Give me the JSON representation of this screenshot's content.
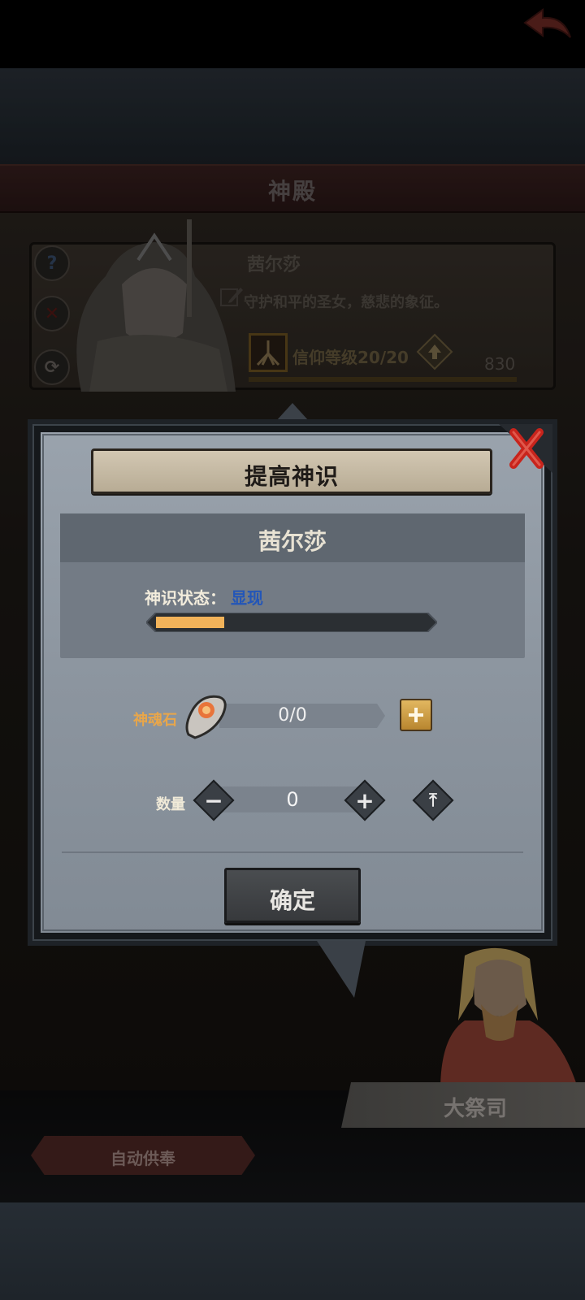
{
  "header": {
    "title": "神殿"
  },
  "hero": {
    "name": "茜尔莎",
    "description": "守护和平的圣女，慈悲的象征。",
    "faith_label": "信仰等级20/20",
    "faith_value": "830",
    "side_buttons": [
      "help-icon",
      "close-icon",
      "refresh-icon"
    ]
  },
  "dialog": {
    "title": "提高神识",
    "character_name": "茜尔莎",
    "state_label": "神识状态：",
    "state_value": "显现",
    "state_progress": 0.25,
    "stone_label": "神魂石",
    "stone_count": "0/0",
    "quantity_label": "数量",
    "quantity_value": "0",
    "confirm_label": "确定"
  },
  "bottom": {
    "priest_name": "大祭司",
    "auto_offer_label": "自动供奉"
  },
  "colors": {
    "accent_gold": "#e2b760",
    "progress_fill": "#f2b35a",
    "state_value_blue": "#2356b8",
    "stone_label_orange": "#e8a64a",
    "close_red": "#c8241c"
  }
}
